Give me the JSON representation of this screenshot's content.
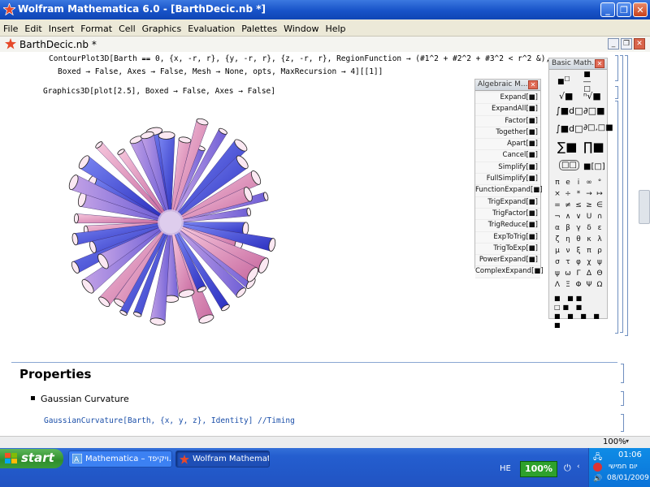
{
  "window": {
    "title": "Wolfram Mathematica 6.0 - [BarthDecic.nb *]",
    "minimize_icon": "_",
    "maximize_icon": "❐",
    "close_icon": "✕"
  },
  "menu": [
    "File",
    "Edit",
    "Insert",
    "Format",
    "Cell",
    "Graphics",
    "Evaluation",
    "Palettes",
    "Window",
    "Help"
  ],
  "document": {
    "title": "BarthDecic.nb *"
  },
  "notebook": {
    "code_line1": "ContourPlot3D[Barth ⩵ 0, {x, -r, r}, {y, -r, r}, {z, -r, r}, RegionFunction → (#1^2 + #2^2 + #3^2 < r^2 &),",
    "code_line2": "Boxed → False, Axes → False, Mesh → None, opts, MaxRecursion → 4][[1]]",
    "code_line3": "Graphics3D[plot[2.5], Boxed → False, Axes → False]",
    "section_title": "Properties",
    "subsection": "Gaussian Curvature",
    "code_line4": "GaussianCurvature[Barth, {x, y, z}, Identity] //Timing",
    "zoom": "100%"
  },
  "algebraic_palette": {
    "title": "Algebraic M...",
    "items": [
      "Expand[■]",
      "ExpandAll[■]",
      "Factor[■]",
      "Together[■]",
      "Apart[■]",
      "Cancel[■]",
      "Simplify[■]",
      "FullSimplify[■]",
      "FunctionExpand[■]",
      "TrigExpand[■]",
      "TrigFactor[■]",
      "TrigReduce[■]",
      "ExpToTrig[■]",
      "TrigToExp[■]",
      "PowerExpand[■]",
      "ComplexExpand[■]"
    ]
  },
  "basic_palette": {
    "title": "Basic Math...",
    "symbol_rows": [
      [
        "π",
        "e",
        "i",
        "∞",
        "°"
      ],
      [
        "×",
        "÷",
        "*",
        "→",
        "↦"
      ],
      [
        "=",
        "≠",
        "≤",
        "≥",
        "∈"
      ],
      [
        "¬",
        "∧",
        "∨",
        "U",
        "∩"
      ],
      [
        "α",
        "β",
        "γ",
        "δ",
        "ε"
      ],
      [
        "ζ",
        "η",
        "θ",
        "κ",
        "λ"
      ],
      [
        "μ",
        "ν",
        "ξ",
        "π",
        "ρ"
      ],
      [
        "σ",
        "τ",
        "φ",
        "χ",
        "ψ"
      ],
      [
        "ψ",
        "ω",
        "Γ",
        "Δ",
        "Θ"
      ],
      [
        "Λ",
        "Ξ",
        "Φ",
        "Ψ",
        "Ω"
      ]
    ]
  },
  "taskbar": {
    "start_label": "start",
    "tasks": [
      "Mathematica – ויקיפד...",
      "Wolfram Mathematica..."
    ],
    "language": "HE",
    "battery": "100%",
    "clock_time": "01:06",
    "clock_day": "יום חמישי",
    "clock_date": "08/01/2009"
  },
  "colors": {
    "title_blue": "#1853c8",
    "taskbar_blue": "#245ecf",
    "start_green": "#3a9c38",
    "surface_pink": "#e8a0c8",
    "surface_blue": "#4a4ee0",
    "code_blue": "#1a4ea8"
  },
  "icons": {
    "app": "mathematica-star-icon",
    "doc": "notebook-star-icon"
  }
}
